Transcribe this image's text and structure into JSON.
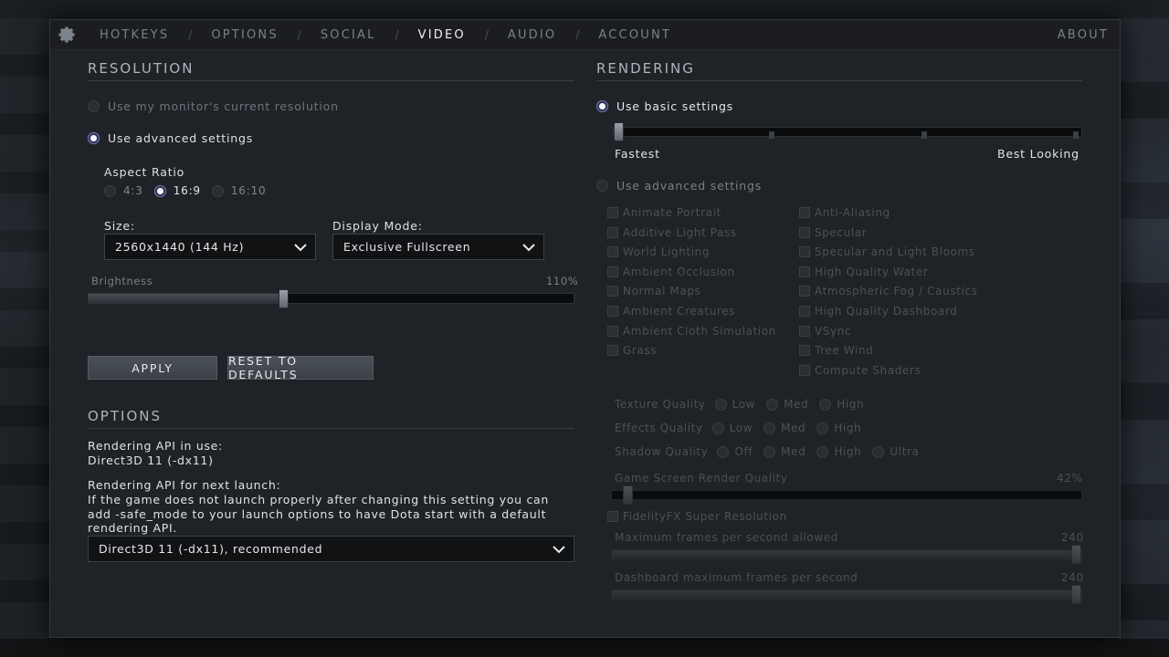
{
  "nav": {
    "tabs": [
      "HOTKEYS",
      "OPTIONS",
      "SOCIAL",
      "VIDEO",
      "AUDIO",
      "ACCOUNT"
    ],
    "active": "VIDEO",
    "about": "ABOUT"
  },
  "resolution": {
    "title": "RESOLUTION",
    "radio_monitor": "Use my monitor's current resolution",
    "radio_advanced": "Use advanced settings",
    "selected": "advanced",
    "aspect_label": "Aspect Ratio",
    "aspect_options": [
      "4:3",
      "16:9",
      "16:10"
    ],
    "aspect_selected": "16:9",
    "size_label": "Size:",
    "size_value": "2560x1440 (144 Hz)",
    "display_mode_label": "Display Mode:",
    "display_mode_value": "Exclusive Fullscreen",
    "brightness_label": "Brightness",
    "brightness_value": "110%",
    "brightness_level": 0.4,
    "apply": "APPLY",
    "reset": "RESET TO DEFAULTS"
  },
  "options": {
    "title": "OPTIONS",
    "api_in_use_label": "Rendering API in use:",
    "api_in_use_value": "Direct3D 11 (-dx11)",
    "api_next_label": "Rendering API for next launch:",
    "api_help": "If the game does not launch properly after changing this setting you can add -safe_mode to your launch options to have Dota start with a default rendering API.",
    "api_next_value": "Direct3D 11 (-dx11), recommended"
  },
  "rendering": {
    "title": "RENDERING",
    "basic_label": "Use basic settings",
    "advanced_label": "Use advanced settings",
    "selected": "basic",
    "slider_min_label": "Fastest",
    "slider_max_label": "Best Looking",
    "slider_level": 0,
    "checkboxes_left": [
      "Animate Portrait",
      "Additive Light Pass",
      "World Lighting",
      "Ambient Occlusion",
      "Normal Maps",
      "Ambient Creatures",
      "Ambient Cloth Simulation",
      "Grass"
    ],
    "checkboxes_right": [
      "Anti-Aliasing",
      "Specular",
      "Specular and Light Blooms",
      "High Quality Water",
      "Atmospheric Fog / Caustics",
      "High Quality Dashboard",
      "VSync",
      "Tree Wind",
      "Compute Shaders"
    ],
    "texture_quality": {
      "label": "Texture Quality",
      "options": [
        "Low",
        "Med",
        "High"
      ]
    },
    "effects_quality": {
      "label": "Effects Quality",
      "options": [
        "Low",
        "Med",
        "High"
      ]
    },
    "shadow_quality": {
      "label": "Shadow Quality",
      "options": [
        "Off",
        "Med",
        "High",
        "Ultra"
      ]
    },
    "render_quality_label": "Game Screen Render Quality",
    "render_quality_value": "42%",
    "render_quality_level": 0.04,
    "fsr_label": "FidelityFX Super Resolution",
    "max_fps_label": "Maximum frames per second allowed",
    "max_fps_value": "240",
    "dash_fps_label": "Dashboard maximum frames per second",
    "dash_fps_value": "240"
  },
  "colors": {
    "panel": "#1f2226",
    "accent_radio": "#9fb2ff",
    "text": "#cfd3d8",
    "disabled": "#4b4f55"
  }
}
